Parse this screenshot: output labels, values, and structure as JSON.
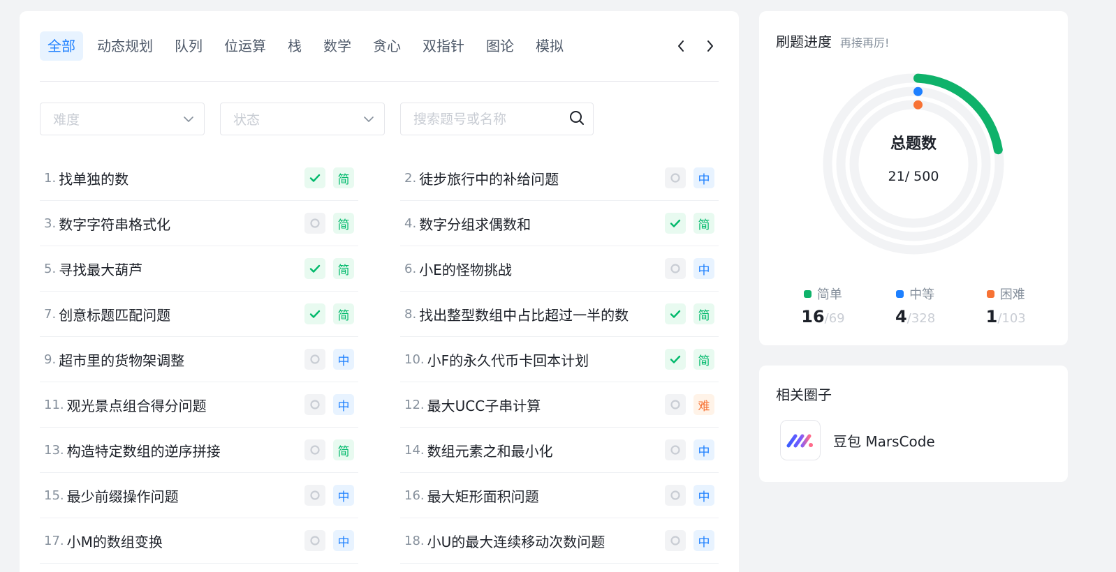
{
  "tabs": [
    "全部",
    "动态规划",
    "队列",
    "位运算",
    "栈",
    "数学",
    "贪心",
    "双指针",
    "图论",
    "模拟"
  ],
  "filters": {
    "difficulty_placeholder": "难度",
    "status_placeholder": "状态",
    "search_placeholder": "搜索题号或名称"
  },
  "problems": [
    {
      "num": "1.",
      "title": "找单独的数",
      "solved": true,
      "difficulty": "简"
    },
    {
      "num": "2.",
      "title": "徒步旅行中的补给问题",
      "solved": false,
      "difficulty": "中"
    },
    {
      "num": "3.",
      "title": "数字字符串格式化",
      "solved": false,
      "difficulty": "简"
    },
    {
      "num": "4.",
      "title": "数字分组求偶数和",
      "solved": true,
      "difficulty": "简"
    },
    {
      "num": "5.",
      "title": "寻找最大葫芦",
      "solved": true,
      "difficulty": "简"
    },
    {
      "num": "6.",
      "title": "小E的怪物挑战",
      "solved": false,
      "difficulty": "中"
    },
    {
      "num": "7.",
      "title": "创意标题匹配问题",
      "solved": true,
      "difficulty": "简"
    },
    {
      "num": "8.",
      "title": "找出整型数组中占比超过一半的数",
      "solved": true,
      "difficulty": "简"
    },
    {
      "num": "9.",
      "title": "超市里的货物架调整",
      "solved": false,
      "difficulty": "中"
    },
    {
      "num": "10.",
      "title": "小F的永久代币卡回本计划",
      "solved": true,
      "difficulty": "简"
    },
    {
      "num": "11.",
      "title": "观光景点组合得分问题",
      "solved": false,
      "difficulty": "中"
    },
    {
      "num": "12.",
      "title": "最大UCC子串计算",
      "solved": false,
      "difficulty": "难"
    },
    {
      "num": "13.",
      "title": "构造特定数组的逆序拼接",
      "solved": false,
      "difficulty": "简"
    },
    {
      "num": "14.",
      "title": "数组元素之和最小化",
      "solved": false,
      "difficulty": "中"
    },
    {
      "num": "15.",
      "title": "最少前缀操作问题",
      "solved": false,
      "difficulty": "中"
    },
    {
      "num": "16.",
      "title": "最大矩形面积问题",
      "solved": false,
      "difficulty": "中"
    },
    {
      "num": "17.",
      "title": "小M的数组变换",
      "solved": false,
      "difficulty": "中"
    },
    {
      "num": "18.",
      "title": "小U的最大连续移动次数问题",
      "solved": false,
      "difficulty": "中"
    }
  ],
  "progress": {
    "title": "刷题进度",
    "subtitle": "再接再厉!",
    "center_label": "总题数",
    "center_count": "21/ 500",
    "levels": [
      {
        "name": "简单",
        "solved": 16,
        "total": 69,
        "total_text": "/69",
        "color": "#0fb26a"
      },
      {
        "name": "中等",
        "solved": 4,
        "total": 328,
        "total_text": "/328",
        "color": "#1e80ff"
      },
      {
        "name": "困难",
        "solved": 1,
        "total": 103,
        "total_text": "/103",
        "color": "#f77234"
      }
    ]
  },
  "circles": {
    "title": "相关圈子",
    "items": [
      {
        "name": "豆包 MarsCode"
      }
    ]
  },
  "colors": {
    "accent": "#1e80ff",
    "easy": "#00b96b",
    "medium": "#1e80ff",
    "hard": "#f77234"
  }
}
